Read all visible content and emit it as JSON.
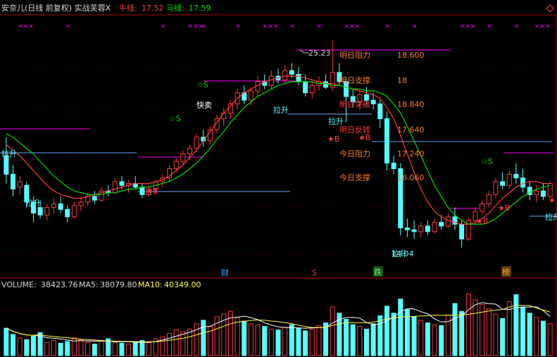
{
  "header": {
    "title": "安奈儿(日线 前复权) 实战芙蓉X",
    "bull_label": "牛线:",
    "bull_value": "17.52",
    "horse_label": "马线:",
    "horse_value": "17.59"
  },
  "levels": {
    "tomorrow_resist_label": "明日阻力",
    "tomorrow_resist_value": "18.600",
    "tomorrow_support_label": "明日支撑",
    "tomorrow_support_value": "18",
    "tomorrow_break_label": "明日突破",
    "tomorrow_break_value": "18.840",
    "tomorrow_reverse_label": "明日反转",
    "tomorrow_reverse_value": "17.640",
    "today_resist_label": "今日阻力",
    "today_resist_value": "17.240",
    "today_support_label": "今日支撑",
    "today_support_value": "16.060"
  },
  "annotations": {
    "high_price": "25.23",
    "low_price": "14.04",
    "lashang": "拉升",
    "lashang_low": "拉升",
    "kuaimai": "快卖",
    "buy": "★B",
    "sell": "☆S",
    "star_only": "★"
  },
  "events": {
    "cai": "财",
    "s": "S",
    "die": "跌",
    "bang": "榜"
  },
  "volume": {
    "label": "VOLUME:",
    "value": "38423.76",
    "ma5_label": "MA5:",
    "ma5_value": "38079.80",
    "ma10_label": "MA10:",
    "ma10_value": "40349.00"
  },
  "colors": {
    "up": "#ff3c3c",
    "down": "#54ffff",
    "bull": "#ff3c3c",
    "horse": "#00e000",
    "magenta": "#ff00ff",
    "level_line": "#6aa8ff",
    "text_level": "#ff7a2a"
  },
  "chart_data": {
    "type": "candlestick",
    "ylim": [
      12.5,
      26.5
    ],
    "candles": [
      [
        19.0,
        20.0,
        17.5,
        18.0
      ],
      [
        18.0,
        18.5,
        16.8,
        17.2
      ],
      [
        17.3,
        17.9,
        16.9,
        17.6
      ],
      [
        17.4,
        17.6,
        16.2,
        16.5
      ],
      [
        16.5,
        16.8,
        15.4,
        15.9
      ],
      [
        16.2,
        16.6,
        15.6,
        15.8
      ],
      [
        15.8,
        16.4,
        15.5,
        16.2
      ],
      [
        16.2,
        16.7,
        15.9,
        16.4
      ],
      [
        16.4,
        16.8,
        15.9,
        16.1
      ],
      [
        16.1,
        16.3,
        15.4,
        15.7
      ],
      [
        15.7,
        16.5,
        15.6,
        16.3
      ],
      [
        16.3,
        16.8,
        16.0,
        16.5
      ],
      [
        16.5,
        17.0,
        16.3,
        16.8
      ],
      [
        16.8,
        17.1,
        16.4,
        16.6
      ],
      [
        16.6,
        17.3,
        16.5,
        17.1
      ],
      [
        17.1,
        17.4,
        16.8,
        17.0
      ],
      [
        17.0,
        17.8,
        16.9,
        17.6
      ],
      [
        17.6,
        17.9,
        17.2,
        17.4
      ],
      [
        17.4,
        17.7,
        17.0,
        17.5
      ],
      [
        17.5,
        17.9,
        17.2,
        17.3
      ],
      [
        17.3,
        17.5,
        16.7,
        16.9
      ],
      [
        16.9,
        17.4,
        16.8,
        17.2
      ],
      [
        17.2,
        17.7,
        17.0,
        17.6
      ],
      [
        17.6,
        18.0,
        17.3,
        17.8
      ],
      [
        17.8,
        18.5,
        17.6,
        18.3
      ],
      [
        18.3,
        18.9,
        18.1,
        18.7
      ],
      [
        18.7,
        19.3,
        18.5,
        19.1
      ],
      [
        19.1,
        19.6,
        18.8,
        19.4
      ],
      [
        19.4,
        20.2,
        19.2,
        20.0
      ],
      [
        20.0,
        20.4,
        19.5,
        19.8
      ],
      [
        19.8,
        20.6,
        19.6,
        20.4
      ],
      [
        20.4,
        21.2,
        20.2,
        21.0
      ],
      [
        21.0,
        21.6,
        20.6,
        21.3
      ],
      [
        21.3,
        22.0,
        21.0,
        21.8
      ],
      [
        21.8,
        22.6,
        21.5,
        22.4
      ],
      [
        22.4,
        22.8,
        21.8,
        22.0
      ],
      [
        22.0,
        22.7,
        21.7,
        22.5
      ],
      [
        22.5,
        23.3,
        22.2,
        23.0
      ],
      [
        23.0,
        23.4,
        22.6,
        22.8
      ],
      [
        22.8,
        23.6,
        22.6,
        23.3
      ],
      [
        23.3,
        23.7,
        22.9,
        23.1
      ],
      [
        23.1,
        23.9,
        22.9,
        23.6
      ],
      [
        23.6,
        24.0,
        23.2,
        23.4
      ],
      [
        23.4,
        23.8,
        22.8,
        23.0
      ],
      [
        23.0,
        23.4,
        22.2,
        22.4
      ],
      [
        22.4,
        23.0,
        22.1,
        22.8
      ],
      [
        22.8,
        23.3,
        22.5,
        23.0
      ],
      [
        23.0,
        23.4,
        22.6,
        22.7
      ],
      [
        22.7,
        25.23,
        22.5,
        23.5
      ],
      [
        23.5,
        24.0,
        22.8,
        23.0
      ],
      [
        23.0,
        23.2,
        20.8,
        22.2
      ],
      [
        22.2,
        22.6,
        21.6,
        21.9
      ],
      [
        21.9,
        22.5,
        21.5,
        22.3
      ],
      [
        22.3,
        22.7,
        21.8,
        22.0
      ],
      [
        22.0,
        22.4,
        21.5,
        21.8
      ],
      [
        21.8,
        22.0,
        20.5,
        21.0
      ],
      [
        21.0,
        21.4,
        18.2,
        18.6
      ],
      [
        18.6,
        19.0,
        18.0,
        18.3
      ],
      [
        18.3,
        18.6,
        14.7,
        15.1
      ],
      [
        15.1,
        15.6,
        14.6,
        15.0
      ],
      [
        15.0,
        15.5,
        14.5,
        14.9
      ],
      [
        14.9,
        15.4,
        14.6,
        15.2
      ],
      [
        15.2,
        15.5,
        14.7,
        14.9
      ],
      [
        14.9,
        15.6,
        14.8,
        15.4
      ],
      [
        15.4,
        15.8,
        15.0,
        15.2
      ],
      [
        15.2,
        15.9,
        15.1,
        15.7
      ],
      [
        15.7,
        16.2,
        15.0,
        15.3
      ],
      [
        15.3,
        15.5,
        14.04,
        14.5
      ],
      [
        14.5,
        15.6,
        14.4,
        15.5
      ],
      [
        15.5,
        16.2,
        15.3,
        16.0
      ],
      [
        16.0,
        16.6,
        15.8,
        16.4
      ],
      [
        16.4,
        17.1,
        16.2,
        16.9
      ],
      [
        16.9,
        17.8,
        16.7,
        17.6
      ],
      [
        17.6,
        18.1,
        17.2,
        17.4
      ],
      [
        17.4,
        18.2,
        17.2,
        18.0
      ],
      [
        18.0,
        18.6,
        17.5,
        17.8
      ],
      [
        17.8,
        18.3,
        17.0,
        17.3
      ],
      [
        17.3,
        17.6,
        16.6,
        16.9
      ],
      [
        16.9,
        17.4,
        16.5,
        17.1
      ],
      [
        17.1,
        17.5,
        16.6,
        16.8
      ],
      [
        16.8,
        17.6,
        16.7,
        17.5
      ]
    ],
    "bull_line": [
      19.6,
      19.3,
      19.0,
      18.6,
      18.2,
      17.8,
      17.4,
      17.1,
      16.9,
      16.8,
      16.7,
      16.7,
      16.8,
      16.9,
      17.0,
      17.1,
      17.2,
      17.3,
      17.4,
      17.5,
      17.5,
      17.5,
      17.6,
      17.7,
      17.9,
      18.2,
      18.5,
      18.9,
      19.3,
      19.8,
      20.3,
      20.8,
      21.3,
      21.7,
      22.1,
      22.4,
      22.6,
      22.8,
      23.0,
      23.1,
      23.2,
      23.3,
      23.3,
      23.3,
      23.2,
      23.1,
      23.0,
      22.9,
      22.9,
      22.8,
      22.7,
      22.6,
      22.5,
      22.4,
      22.3,
      22.1,
      21.6,
      21.0,
      20.1,
      19.1,
      18.1,
      17.2,
      16.5,
      16.0,
      15.7,
      15.5,
      15.4,
      15.3,
      15.3,
      15.4,
      15.6,
      15.9,
      16.3,
      16.7,
      17.0,
      17.3,
      17.5,
      17.6,
      17.6,
      17.5,
      17.5
    ],
    "horse_line": [
      20.2,
      20.0,
      19.7,
      19.4,
      19.1,
      18.7,
      18.3,
      17.9,
      17.6,
      17.3,
      17.1,
      17.0,
      16.9,
      16.9,
      16.9,
      17.0,
      17.0,
      17.1,
      17.2,
      17.2,
      17.3,
      17.3,
      17.4,
      17.5,
      17.6,
      17.8,
      18.0,
      18.3,
      18.6,
      19.0,
      19.4,
      19.9,
      20.3,
      20.8,
      21.2,
      21.6,
      21.9,
      22.2,
      22.4,
      22.6,
      22.8,
      22.9,
      23.0,
      23.0,
      23.0,
      23.0,
      22.9,
      22.9,
      22.8,
      22.8,
      22.7,
      22.6,
      22.6,
      22.5,
      22.5,
      22.4,
      22.2,
      21.8,
      21.3,
      20.6,
      19.8,
      19.0,
      18.2,
      17.4,
      16.8,
      16.2,
      15.8,
      15.5,
      15.3,
      15.3,
      15.3,
      15.4,
      15.6,
      15.9,
      16.2,
      16.5,
      16.8,
      17.0,
      17.2,
      17.3,
      17.4
    ],
    "volume": [
      62,
      48,
      40,
      36,
      44,
      52,
      30,
      34,
      28,
      32,
      40,
      36,
      30,
      26,
      34,
      38,
      30,
      28,
      26,
      30,
      34,
      32,
      38,
      42,
      50,
      58,
      54,
      60,
      72,
      80,
      66,
      88,
      94,
      100,
      86,
      78,
      72,
      70,
      66,
      60,
      58,
      64,
      70,
      62,
      56,
      60,
      68,
      74,
      110,
      96,
      82,
      70,
      66,
      60,
      72,
      90,
      112,
      96,
      128,
      104,
      88,
      80,
      74,
      70,
      68,
      92,
      118,
      100,
      140,
      126,
      116,
      106,
      94,
      84,
      122,
      138,
      110,
      96,
      86,
      78,
      72
    ]
  }
}
